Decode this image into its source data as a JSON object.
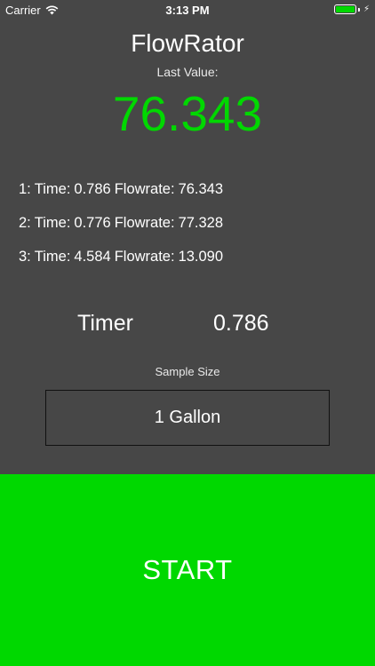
{
  "status_bar": {
    "carrier": "Carrier",
    "time": "3:13 PM",
    "battery_level": 1.0,
    "battery_color": "#00d800",
    "icons": [
      "wifi-icon",
      "battery-icon",
      "charging-bolt-icon"
    ]
  },
  "app": {
    "title": "FlowRator",
    "last_value_label": "Last Value:",
    "last_value": "76.343",
    "accent_color": "#00d800",
    "background_color": "#474747"
  },
  "history": [
    {
      "index": "1:",
      "time_label": "Time:",
      "time": "0.786",
      "flow_label": "Flowrate:",
      "flow": "76.343"
    },
    {
      "index": "2:",
      "time_label": "Time:",
      "time": "0.776",
      "flow_label": "Flowrate:",
      "flow": "77.328"
    },
    {
      "index": "3:",
      "time_label": "Time:",
      "time": "4.584",
      "flow_label": "Flowrate:",
      "flow": "13.090"
    }
  ],
  "timer": {
    "label": "Timer",
    "value": "0.786"
  },
  "sample": {
    "label": "Sample Size",
    "selected": "1 Gallon"
  },
  "start_button": {
    "label": "START",
    "color": "#00d800"
  }
}
